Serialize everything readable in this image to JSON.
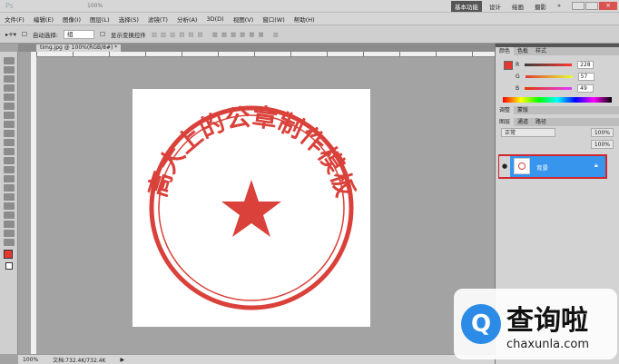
{
  "app": {
    "logo": "Ps",
    "zoom": "100%",
    "workspaces": [
      "基本功能",
      "设计",
      "绘画",
      "摄影"
    ],
    "more": "»"
  },
  "menu": [
    "文件(F)",
    "编辑(E)",
    "图像(I)",
    "图层(L)",
    "选择(S)",
    "滤镜(T)",
    "分析(A)",
    "3D(D)",
    "视图(V)",
    "窗口(W)",
    "帮助(H)"
  ],
  "options": {
    "auto_select": "自动选择:",
    "auto_select_value": "组",
    "show_transform": "显示变换控件"
  },
  "document": {
    "tab": "timg.jpg @ 100%(RGB/8#) *"
  },
  "stamp": {
    "text": "高大上的公章制作模板",
    "color": "#d9413a"
  },
  "color_panel": {
    "tabs": [
      "颜色",
      "色板",
      "样式"
    ],
    "r": "228",
    "g": "57",
    "b": "49",
    "labels": [
      "R",
      "G",
      "B"
    ],
    "fg": "#e43931"
  },
  "adjust_panel": {
    "tabs": [
      "调整",
      "蒙版"
    ]
  },
  "layers_panel": {
    "tabs": [
      "图层",
      "通道",
      "路径"
    ],
    "blend": "正常",
    "opacity": "100%",
    "fill": "100%",
    "layer_name": "背景"
  },
  "status": {
    "zoom": "100%",
    "doc": "文档:732.4K/732.4K"
  },
  "watermark": {
    "name": "查询啦",
    "url": "chaxunla.com"
  }
}
